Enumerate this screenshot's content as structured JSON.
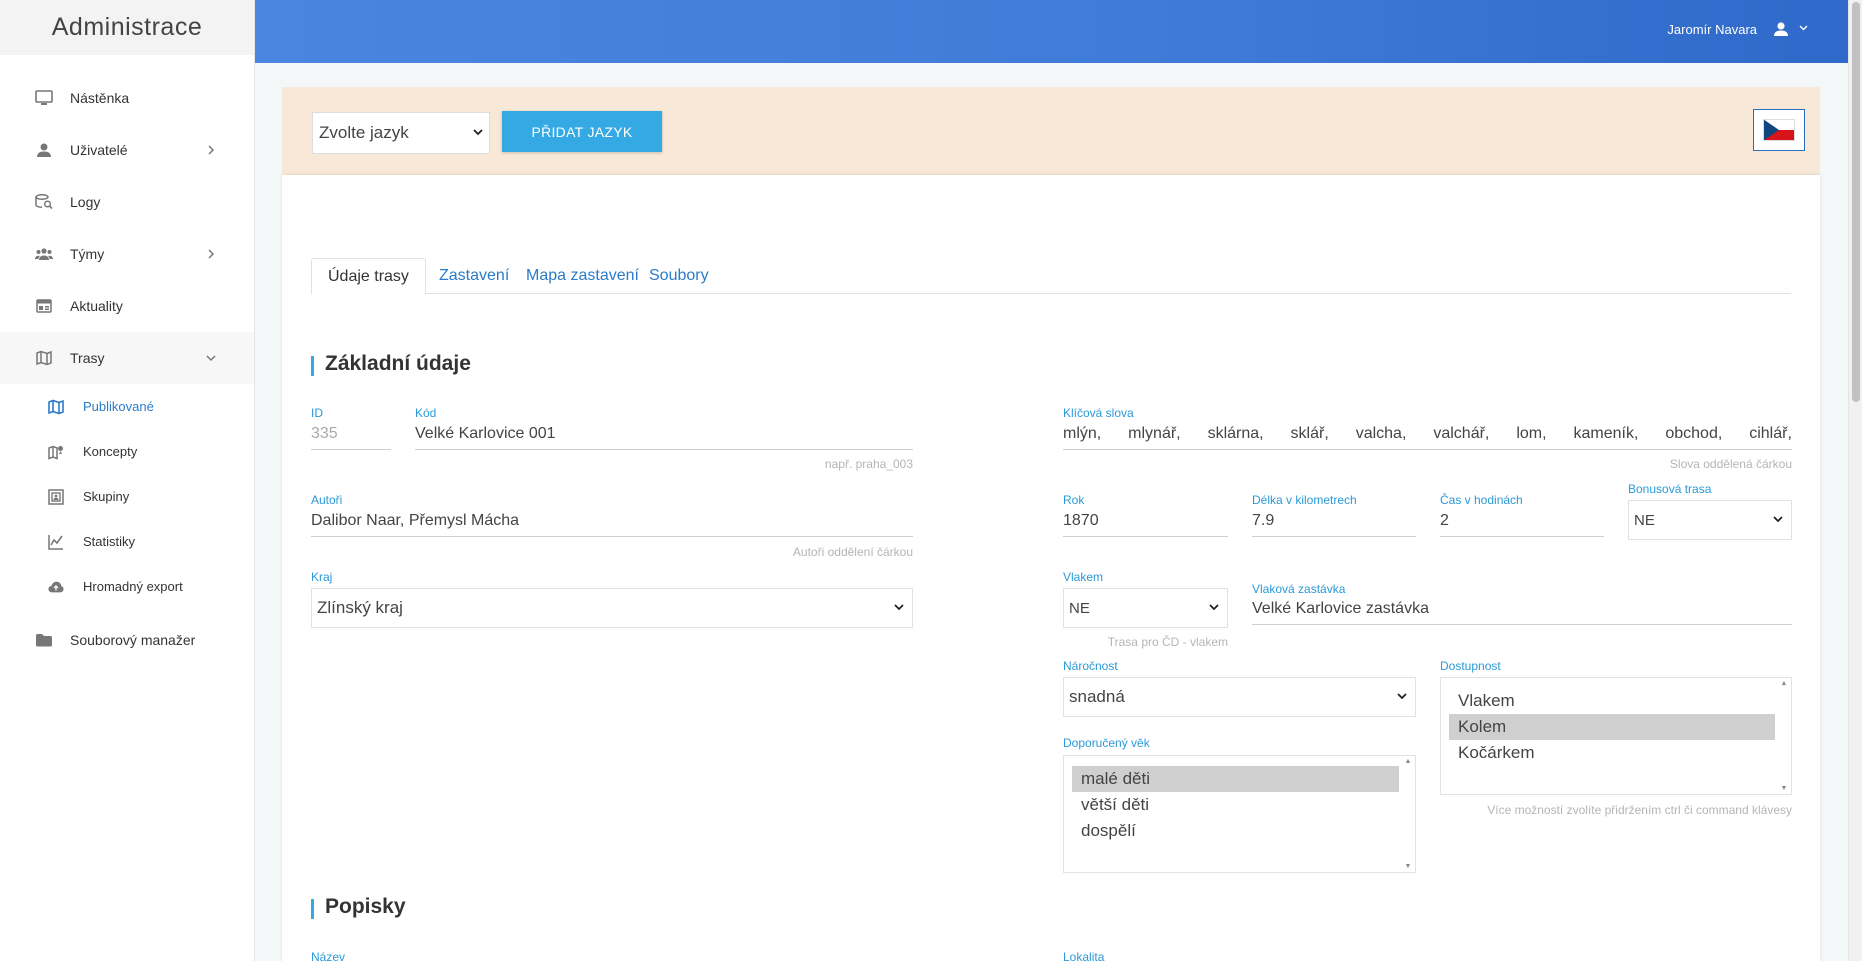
{
  "sidebar": {
    "brand": "Administrace",
    "items": [
      {
        "label": "Nástěnka",
        "icon": "monitor-icon"
      },
      {
        "label": "Uživatelé",
        "icon": "user-icon"
      },
      {
        "label": "Logy",
        "icon": "database-search-icon"
      },
      {
        "label": "Týmy",
        "icon": "group-icon"
      },
      {
        "label": "Aktuality",
        "icon": "news-icon"
      },
      {
        "label": "Trasy",
        "icon": "map-icon"
      }
    ],
    "sub_items": [
      {
        "label": "Publikované",
        "icon": "map-icon"
      },
      {
        "label": "Koncepty",
        "icon": "map-pin-icon"
      },
      {
        "label": "Skupiny",
        "icon": "group-frame-icon"
      },
      {
        "label": "Statistiky",
        "icon": "chart-icon"
      },
      {
        "label": "Hromadný export",
        "icon": "cloud-upload-icon"
      }
    ],
    "file_manager": {
      "label": "Souborový manažer",
      "icon": "folder-icon"
    }
  },
  "header": {
    "user_name": "Jaromír Navara"
  },
  "lang_bar": {
    "select_value": "Zvolte jazyk",
    "add_button": "PŘIDAT JAZYK"
  },
  "tabs": [
    "Údaje trasy",
    "Zastavení",
    "Mapa zastavení",
    "Soubory"
  ],
  "basic": {
    "title": "Základní údaje",
    "id_label": "ID",
    "id_value": "335",
    "code_label": "Kód",
    "code_value": "Velké Karlovice 001",
    "code_hint": "např. praha_003",
    "authors_label": "Autoři",
    "authors_value": "Dalibor Naar, Přemysl Mácha",
    "authors_hint": "Autoři oddělení čárkou",
    "region_label": "Kraj",
    "region_value": "Zlínský kraj",
    "keywords_label": "Klíčová slova",
    "keywords": [
      "mlýn,",
      "mlynář,",
      "sklárna,",
      "sklář,",
      "valcha,",
      "valchář,",
      "lom,",
      "kameník,",
      "obchod,",
      "cihlář,"
    ],
    "keywords_hint": "Slova oddělená čárkou",
    "year_label": "Rok",
    "year_value": "1870",
    "length_label": "Délka v kilometrech",
    "length_value": "7.9",
    "time_label": "Čas v hodinách",
    "time_value": "2",
    "bonus_label": "Bonusová trasa",
    "bonus_value": "NE",
    "train_label": "Vlakem",
    "train_value": "NE",
    "train_hint": "Trasa pro ČD - vlakem",
    "station_label": "Vlaková zastávka",
    "station_value": "Velké Karlovice zastávka",
    "difficulty_label": "Náročnost",
    "difficulty_value": "snadná",
    "access_label": "Dostupnost",
    "access_options": [
      "Vlakem",
      "Kolem",
      "Kočárkem"
    ],
    "access_hint": "Více možností zvolíte přidržením ctrl či command klávesy",
    "age_label": "Doporučený věk",
    "age_options": [
      "malé děti",
      "větší děti",
      "dospělí"
    ]
  },
  "descriptions": {
    "title": "Popisky",
    "name_label": "Název",
    "locality_label": "Lokalita"
  },
  "colors": {
    "accent": "#35a9e4",
    "header_gradient_start": "#4a86e0",
    "header_gradient_end": "#2f69c9",
    "lang_bar_bg": "#f8e8d8",
    "link": "#2a7bc9"
  }
}
